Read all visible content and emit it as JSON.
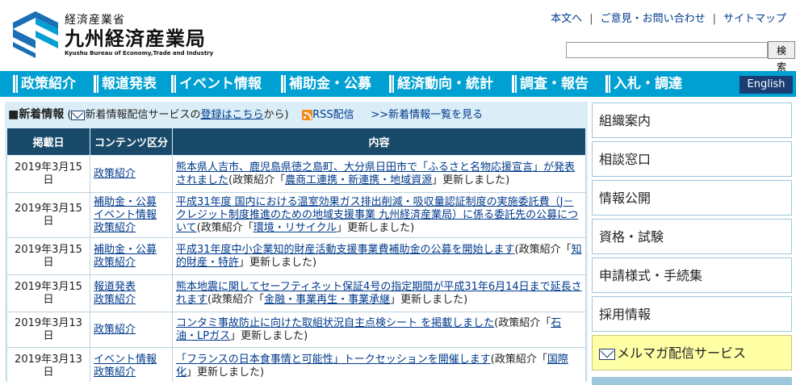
{
  "header": {
    "org_sub": "経済産業省",
    "org_main": "九州経済産業局",
    "org_en": "Kyushu Bureau of Economy,Trade and Industry",
    "util_links": [
      "本文へ",
      "ご意見・お問い合わせ",
      "サイトマップ"
    ],
    "search_value": "",
    "search_button": "検索"
  },
  "nav": {
    "items": [
      "政策紹介",
      "報道発表",
      "イベント情報",
      "補助金・公募",
      "経済動向・統計",
      "調査・報告",
      "入札・調達"
    ],
    "english": "English"
  },
  "news": {
    "title": "■新着情報",
    "subscribe_prefix": "(",
    "subscribe_text": "新着情報配信サービスの",
    "subscribe_link": "登録はこちら",
    "subscribe_suffix": "から)",
    "rss": "RSS配信",
    "more": ">>新着情報一覧を見る",
    "columns": [
      "掲載日",
      "コンテンツ区分",
      "内容"
    ],
    "rows": [
      {
        "date": "2019年3月15日",
        "categories": [
          "政策紹介"
        ],
        "link": "熊本県人吉市、鹿児島県徳之島町、大分県日田市で「ふるさと名物応援宣言」が発表されました",
        "note": "(政策紹介「",
        "tag": "農商工連携・新連携・地域資源",
        "tail": "」更新しました)"
      },
      {
        "date": "2019年3月15日",
        "categories": [
          "補助金・公募",
          "イベント情報",
          "政策紹介"
        ],
        "link": "平成31年度 国内における温室効果ガス排出削減・吸収量認証制度の実施委託費（J－クレジット制度推進のための地域支援事業 九州経済産業局）に係る委託先の公募について",
        "note": "(政策紹介「",
        "tag": "環境・リサイクル",
        "tail": "」更新しました)"
      },
      {
        "date": "2019年3月15日",
        "categories": [
          "補助金・公募",
          "政策紹介"
        ],
        "link": "平成31年度中小企業知的財産活動支援事業費補助金の公募を開始します",
        "note": "(政策紹介「",
        "tag": "知的財産・特許",
        "tail": "」更新しました)"
      },
      {
        "date": "2019年3月15日",
        "categories": [
          "報道発表",
          "政策紹介"
        ],
        "link": "熊本地震に関してセーフティネット保証4号の指定期間が平成31年6月14日まで延長されます",
        "note": "(政策紹介「",
        "tag": "金融・事業再生・事業承継",
        "tail": "」更新しました)"
      },
      {
        "date": "2019年3月13日",
        "categories": [
          "政策紹介"
        ],
        "link": "コンタミ事故防止に向けた取組状況自主点検シート を掲載しました",
        "note": "(政策紹介「",
        "tag": "石油・LPガス",
        "tail": "」更新しました)"
      },
      {
        "date": "2019年3月13日",
        "categories": [
          "イベント情報",
          "政策紹介"
        ],
        "link": "「フランスの日本食事情と可能性」トークセッションを開催します",
        "note": "(政策紹介「",
        "tag": "国際化",
        "tail": "」更新しました)"
      }
    ]
  },
  "sidebar": {
    "items": [
      "組織案内",
      "相談窓口",
      "情報公開",
      "資格・試験",
      "申請様式・手続集",
      "採用情報",
      "メルマガ配信サービス"
    ]
  }
}
